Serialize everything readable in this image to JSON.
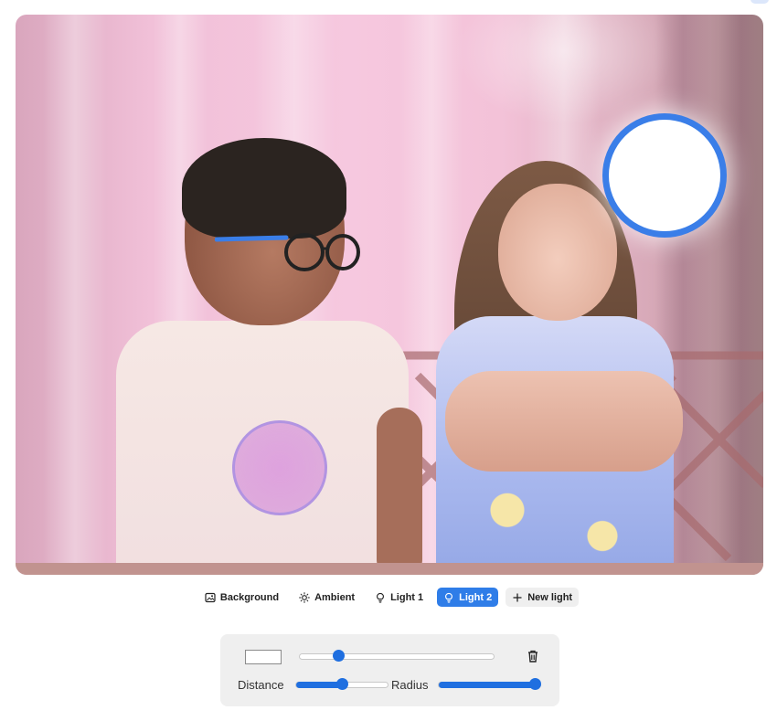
{
  "tabs": [
    {
      "label": "Background",
      "icon": "image-icon",
      "active": false
    },
    {
      "label": "Ambient",
      "icon": "sun-icon",
      "active": false
    },
    {
      "label": "Light 1",
      "icon": "lightbulb-icon",
      "active": false
    },
    {
      "label": "Light 2",
      "icon": "lightbulb-icon",
      "active": true
    },
    {
      "label": "New light",
      "icon": "plus-icon",
      "active": false
    }
  ],
  "panel": {
    "color": "#ffffff",
    "color_slider_value": 0.2,
    "distance_label": "Distance",
    "distance_value": 0.5,
    "radius_label": "Radius",
    "radius_value": 0.95,
    "delete_icon": "trash-icon"
  },
  "colors": {
    "accent": "#2f7de8",
    "light_2_ring": "#3a7ee8",
    "panel_bg": "#efefef"
  }
}
